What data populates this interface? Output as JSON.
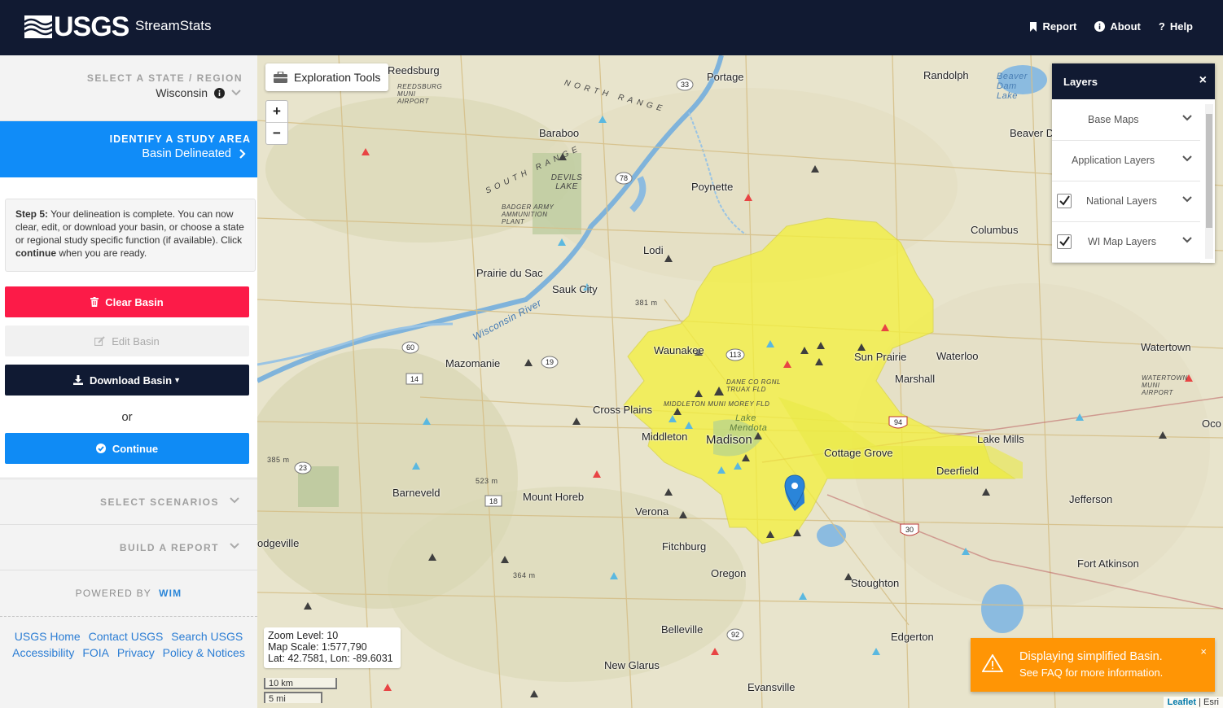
{
  "header": {
    "logo_text": "USGS",
    "app_name": "StreamStats",
    "nav": [
      {
        "label": "Report",
        "icon": "bookmark-icon"
      },
      {
        "label": "About",
        "icon": "info-icon"
      },
      {
        "label": "Help",
        "icon": "question-icon"
      }
    ]
  },
  "sidebar": {
    "state_section": {
      "label": "SELECT A STATE / REGION",
      "value": "Wisconsin"
    },
    "identify_section": {
      "label": "IDENTIFY A STUDY AREA",
      "status": "Basin Delineated"
    },
    "step": {
      "bold": "Step 5:",
      "text1": " Your delineation is complete. You can now clear, edit, or download your basin, or choose a state or regional study specific function (if available). Click ",
      "bold2": "continue",
      "text2": " when you are ready."
    },
    "buttons": {
      "clear": "Clear Basin",
      "edit": "Edit Basin",
      "download": "Download Basin",
      "or": "or",
      "continue": "Continue"
    },
    "scenarios_label": "SELECT SCENARIOS",
    "report_label": "BUILD A REPORT",
    "powered_by": "POWERED BY",
    "powered_brand": "WIM",
    "footer_links": [
      "USGS Home",
      "Contact USGS",
      "Search USGS",
      "Accessibility",
      "FOIA",
      "Privacy",
      "Policy & Notices"
    ]
  },
  "map": {
    "exploration_tools": "Exploration Tools",
    "zoom_in": "+",
    "zoom_out": "−",
    "layers": {
      "title": "Layers",
      "close": "×",
      "items": [
        {
          "label": "Base Maps",
          "checked": false
        },
        {
          "label": "Application Layers",
          "checked": false
        },
        {
          "label": "National Layers",
          "checked": true
        },
        {
          "label": "WI Map Layers",
          "checked": true
        }
      ]
    },
    "info": {
      "zoom": "Zoom Level: 10",
      "scale": "Map Scale: 1:577,790",
      "latlon": "Lat: 42.7581, Lon: -89.6031"
    },
    "scale_km": "10 km",
    "scale_mi": "5 mi",
    "toast": {
      "title": "Displaying simplified Basin.",
      "sub": "See FAQ for more information.",
      "close": "×"
    },
    "attribution": {
      "leaflet": "Leaflet",
      "sep": " | ",
      "esri": "Esri"
    },
    "places": [
      "Reedsburg",
      "Portage",
      "Randolph",
      "Baraboo",
      "Poynette",
      "Lodi",
      "Columbus",
      "Prairie du Sac",
      "Sauk City",
      "Waunakee",
      "Sun Prairie",
      "Waterloo",
      "Watertown",
      "Marshall",
      "Mazomanie",
      "Cross Plains",
      "Middleton",
      "Madison",
      "Cottage Grove",
      "Lake Mills",
      "Deerfield",
      "Barneveld",
      "Mount Horeb",
      "Verona",
      "Jefferson",
      "Fitchburg",
      "Oregon",
      "Stoughton",
      "Fort Atkinson",
      "Belleville",
      "Edgerton",
      "New Glarus",
      "Evansville",
      "Beaver D",
      "Oco",
      "odgeville"
    ],
    "small_labels": [
      "Beaver Dam Lake",
      "NORTH RANGE",
      "SOUTH RANGE",
      "DEVILS LAKE",
      "BADGER ARMY AMMUNITION PLANT",
      "REEDSBURG MUNI AIRPORT",
      "Wisconsin River",
      "DANE CO RGNL TRUAX FLD",
      "MIDDLETON MUNI MOREY FLD",
      "Lake Mendota",
      "WATERTOWN MUNI AIRPORT",
      "381 m",
      "385 m",
      "523 m",
      "364 m"
    ],
    "highways": [
      "33",
      "78",
      "60",
      "19",
      "14",
      "113",
      "94",
      "23",
      "18",
      "30",
      "92"
    ]
  }
}
